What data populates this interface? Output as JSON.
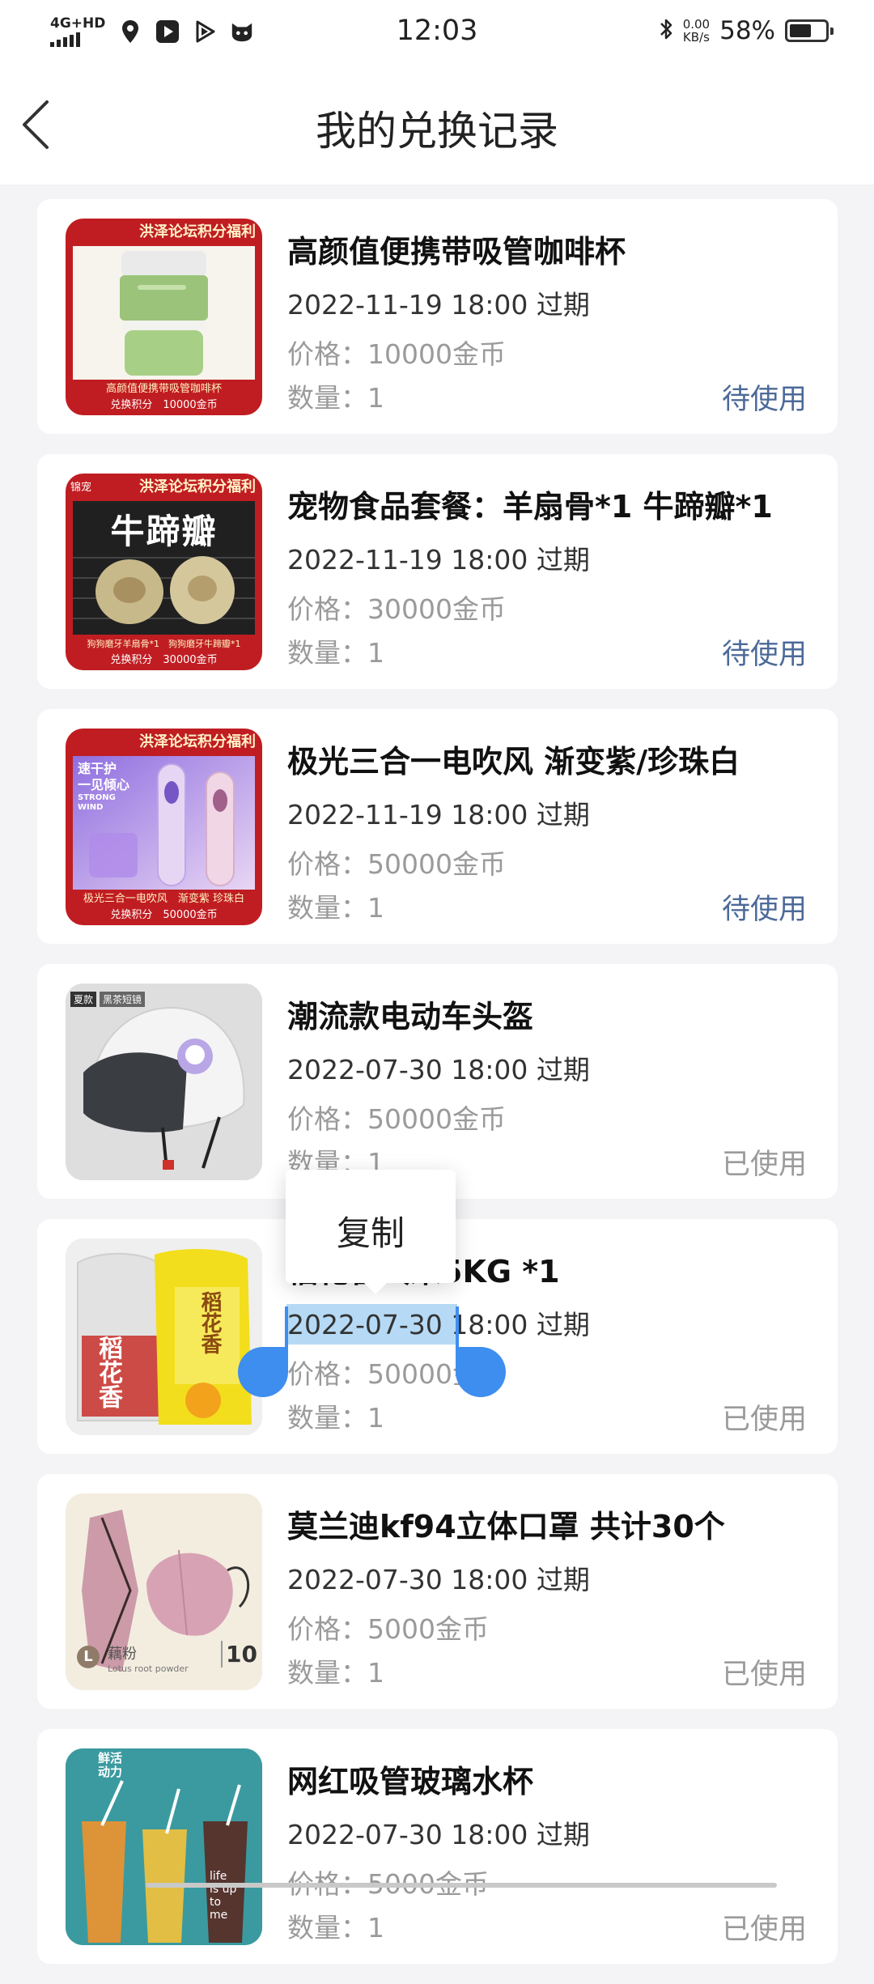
{
  "status_bar": {
    "network": "4G+HD",
    "time": "12:03",
    "speed_value": "0.00",
    "speed_unit": "KB/s",
    "battery": "58%",
    "battery_level": 0.58,
    "icons": [
      "signal-icon",
      "location-icon",
      "video-app-icon",
      "play-app-icon",
      "cat-app-icon",
      "bluetooth-icon",
      "battery-icon"
    ]
  },
  "nav": {
    "title": "我的兑换记录",
    "back_icon": "chevron-left-icon"
  },
  "records": [
    {
      "title": "高颜值便携带吸管咖啡杯",
      "date": "2022-11-19 18:00 过期",
      "price": "价格：10000金币",
      "qty": "数量：1",
      "status": "待使用",
      "thumb": {
        "banner": "洪泽论坛积分福利",
        "foot1": "高颜值便携带吸管咖啡杯",
        "foot2": "兑换积分　10000金币"
      }
    },
    {
      "title": "宠物食品套餐：羊扇骨*1 牛蹄瓣*1",
      "date": "2022-11-19 18:00 过期",
      "price": "价格：30000金币",
      "qty": "数量：1",
      "status": "待使用",
      "thumb": {
        "banner": "洪泽论坛积分福利",
        "tag": "锦宠",
        "headline": "牛蹄瓣",
        "foot1": "狗狗磨牙羊扇骨*1　狗狗磨牙牛蹄瓣*1",
        "foot2": "兑换积分　30000金币"
      }
    },
    {
      "title": "极光三合一电吹风 渐变紫/珍珠白",
      "date": "2022-11-19 18:00 过期",
      "price": "价格：50000金币",
      "qty": "数量：1",
      "status": "待使用",
      "thumb": {
        "banner": "洪泽论坛积分福利",
        "side1": "速干护",
        "side2": "一见倾心",
        "side3": "STRONG WIND",
        "foot1": "极光三合一电吹风　渐变紫 珍珠白",
        "foot2": "兑换积分　50000金币"
      }
    },
    {
      "title": "潮流款电动车头盔",
      "date": "2022-07-30 18:00 过期",
      "price": "价格：50000金币",
      "qty": "数量：1",
      "status": "已使用",
      "thumb": {
        "tag1": "夏款",
        "tag2": "黑茶短镜"
      }
    },
    {
      "title": "稻花香大米5KG *1",
      "date": "2022-07-30 18:00 过期",
      "price": "价格：50000金币",
      "qty": "数量：1",
      "status": "已使用",
      "thumb": {
        "label1": "稻花香",
        "label2": "稻花香"
      }
    },
    {
      "title": "莫兰迪kf94立体口罩 共计30个",
      "date": "2022-07-30 18:00 过期",
      "price": "价格：5000金币",
      "qty": "数量：1",
      "status": "已使用",
      "thumb": {
        "badge": "L",
        "color_cn": "藕粉",
        "color_en": "Lotus root powder",
        "count": "10"
      }
    },
    {
      "title": "网红吸管玻璃水杯",
      "date": "2022-07-30 18:00 过期",
      "price": "价格：5000金币",
      "qty": "数量：1",
      "status": "已使用",
      "thumb": {
        "text": "鲜活动力",
        "cup": "life is up to me"
      }
    }
  ],
  "context_menu": {
    "label": "复制",
    "selected_text": "2022-07-30"
  }
}
